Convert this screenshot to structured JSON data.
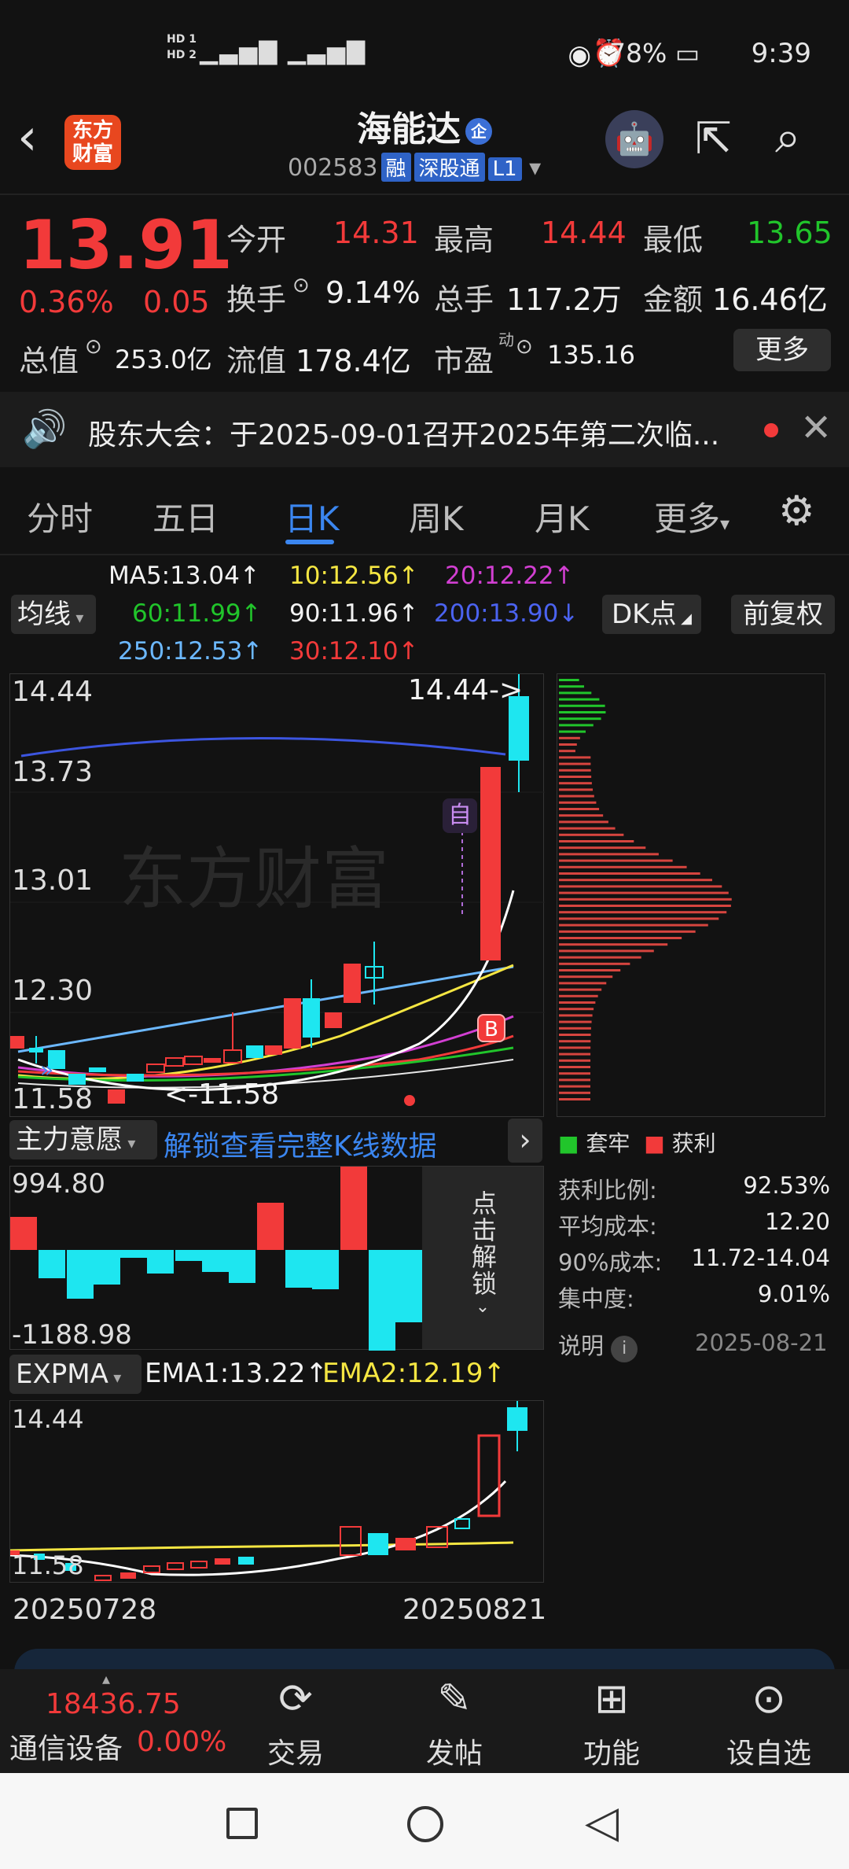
{
  "status_bar": {
    "hd1": "HD 1",
    "hd2": "HD 2",
    "signal": "5G 5G",
    "battery": "78%",
    "time": "9:39"
  },
  "header": {
    "logo_text": "东方财富",
    "stock_name": "海能达",
    "name_badge": "企",
    "code": "002583",
    "tags": [
      "融",
      "深股通",
      "L1"
    ]
  },
  "quote": {
    "price": "13.91",
    "pct": "0.36%",
    "change": "0.05",
    "open_label": "今开",
    "open": "14.31",
    "high_label": "最高",
    "high": "14.44",
    "low_label": "最低",
    "low": "13.65",
    "turnover_label": "换手",
    "turnover": "9.14%",
    "volume_label": "总手",
    "volume": "117.2万",
    "amount_label": "金额",
    "amount": "16.46亿",
    "mcap_label": "总值",
    "mcap": "253.0亿",
    "float_label": "流值",
    "float": "178.4亿",
    "pe_label": "市盈",
    "pe_sup": "动",
    "pe": "135.16",
    "more": "更多"
  },
  "notice": {
    "text": "股东大会：于2025-09-01召开2025年第二次临..."
  },
  "tabs": [
    "分时",
    "五日",
    "日K",
    "周K",
    "月K",
    "更多"
  ],
  "ma": {
    "selector": "均线",
    "ma5": "MA5:13.04↑",
    "ma10": "10:12.56↑",
    "ma20": "20:12.22↑",
    "ma60": "60:11.99↑",
    "ma90": "90:11.96↑",
    "ma200": "200:13.90↓",
    "ma250": "250:12.53↑",
    "ma30": "30:12.10↑",
    "dk": "DK点",
    "adjust": "前复权"
  },
  "kline": {
    "y_ticks": [
      "14.44",
      "13.73",
      "13.01",
      "12.30",
      "11.58"
    ],
    "high_mark": "14.44->",
    "low_mark": "<-11.58",
    "self_tag": "自",
    "b_tag": "B",
    "watermark": "东方财富"
  },
  "colors": {
    "up": "#f23a3a",
    "down": "#1ee6f0",
    "ma5": "#ffffff",
    "ma10": "#f5e642",
    "ma20": "#d23fd2",
    "ma60": "#21c52b",
    "ma200": "#3c55e0",
    "ma250": "#6cb8ff",
    "ma30": "#f23a3a"
  },
  "chip": {
    "legend_trap": "套牢",
    "legend_profit": "获利",
    "rows": [
      {
        "label": "获利比例:",
        "value": "92.53%"
      },
      {
        "label": "平均成本:",
        "value": "12.20"
      },
      {
        "label": "90%成本:",
        "value": "11.72-14.04"
      },
      {
        "label": "集中度:",
        "value": "9.01%"
      }
    ],
    "note": "说明",
    "date": "2025-08-21"
  },
  "main_force": {
    "selector": "主力意愿",
    "unlock": "解锁查看完整K线数据",
    "max": "994.80",
    "min": "-1188.98",
    "overlay": "点击解锁"
  },
  "expma": {
    "selector": "EXPMA",
    "ema1": "EMA1:13.22↑",
    "ema2": "EMA2:12.19↑",
    "y_top": "14.44",
    "y_bot": "11.58",
    "date_start": "20250728",
    "date_end": "20250821"
  },
  "bottom_nav": {
    "index_value": "18436.75",
    "index_name": "通信设备",
    "index_pct": "0.00%",
    "items": [
      "交易",
      "发帖",
      "功能",
      "设自选"
    ]
  },
  "icons": {
    "back": "back-arrow-icon",
    "share": "share-icon",
    "search": "search-icon",
    "settings": "gear-icon",
    "close": "close-icon"
  }
}
